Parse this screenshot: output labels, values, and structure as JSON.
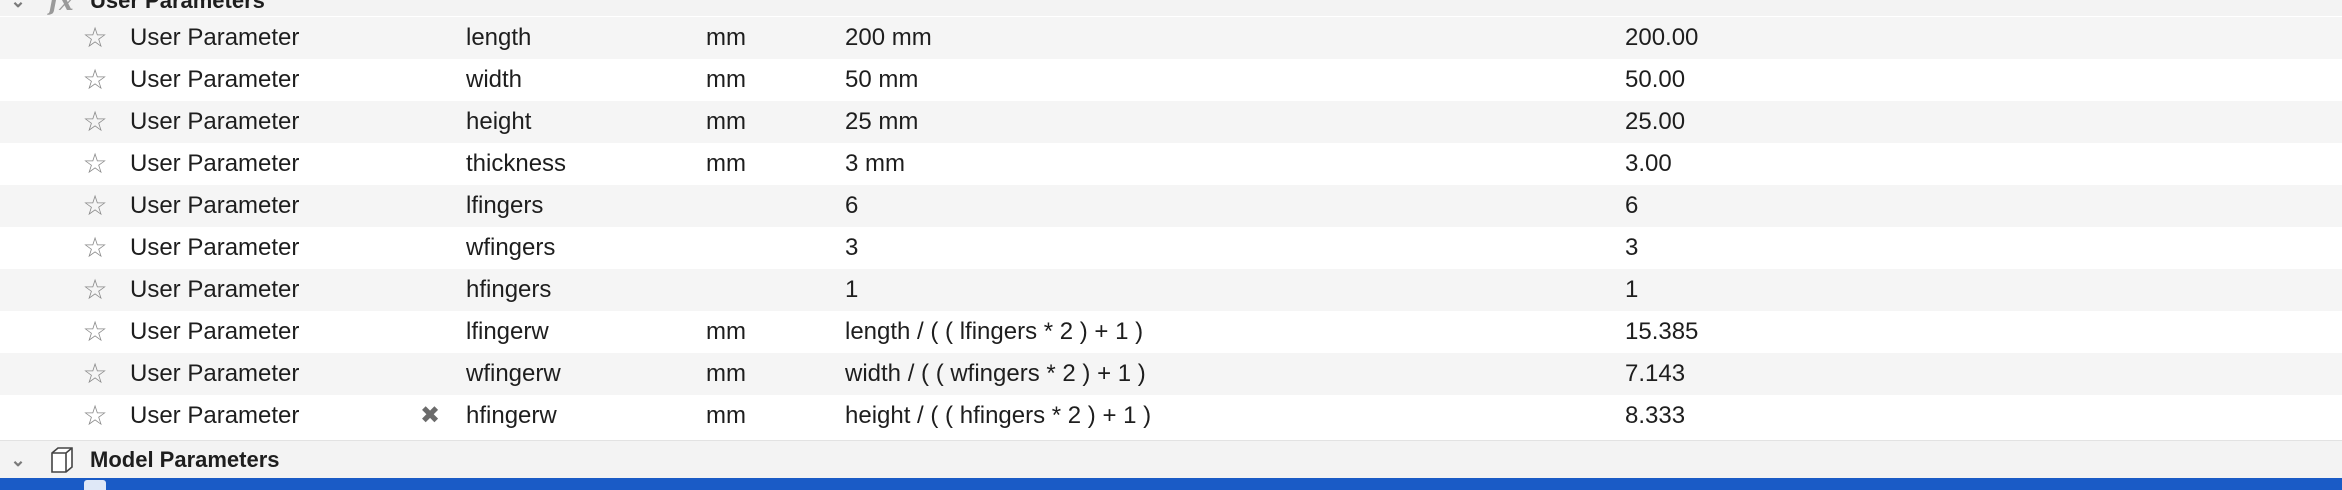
{
  "groups": {
    "user": {
      "label": "User Parameters",
      "icon": "fx-icon",
      "fx": "fx"
    },
    "model": {
      "label": "Model Parameters",
      "icon": "cube-icon"
    }
  },
  "star_glyph": "☆",
  "delete_glyph": "✖",
  "rows": [
    {
      "source": "User Parameter",
      "name": "length",
      "unit": "mm",
      "expression": "200 mm",
      "value": "200.00"
    },
    {
      "source": "User Parameter",
      "name": "width",
      "unit": "mm",
      "expression": "50 mm",
      "value": "50.00"
    },
    {
      "source": "User Parameter",
      "name": "height",
      "unit": "mm",
      "expression": "25 mm",
      "value": "25.00"
    },
    {
      "source": "User Parameter",
      "name": "thickness",
      "unit": "mm",
      "expression": "3 mm",
      "value": "3.00"
    },
    {
      "source": "User Parameter",
      "name": "lfingers",
      "unit": "",
      "expression": "6",
      "value": "6"
    },
    {
      "source": "User Parameter",
      "name": "wfingers",
      "unit": "",
      "expression": "3",
      "value": "3"
    },
    {
      "source": "User Parameter",
      "name": "hfingers",
      "unit": "",
      "expression": "1",
      "value": "1"
    },
    {
      "source": "User Parameter",
      "name": "lfingerw",
      "unit": "mm",
      "expression": "length / ( ( lfingers * 2 ) + 1 )",
      "value": "15.385"
    },
    {
      "source": "User Parameter",
      "name": "wfingerw",
      "unit": "mm",
      "expression": "width / ( ( wfingers * 2 ) + 1 )",
      "value": "7.143"
    },
    {
      "source": "User Parameter",
      "name": "hfingerw",
      "unit": "mm",
      "expression": "height / ( ( hfingers * 2 ) + 1 )",
      "value": "8.333"
    }
  ],
  "colors": {
    "selection": "#1a5bc6",
    "alt_row": "#f5f5f5"
  }
}
